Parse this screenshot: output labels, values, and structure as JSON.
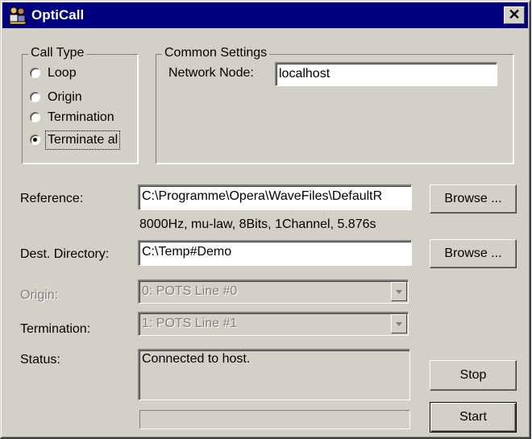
{
  "window": {
    "title": "OptiCall",
    "close_glyph": "✕"
  },
  "call_type": {
    "legend": "Call Type",
    "options": [
      {
        "label": "Loop",
        "checked": false
      },
      {
        "label": "Origin",
        "checked": false
      },
      {
        "label": "Termination",
        "checked": false
      },
      {
        "label": "Terminate al",
        "checked": true
      }
    ]
  },
  "common_settings": {
    "legend": "Common Settings",
    "network_node_label": "Network Node:",
    "network_node_value": "localhost"
  },
  "reference": {
    "label": "Reference:",
    "value": "C:\\Programme\\Opera\\WaveFiles\\DefaultR",
    "info": "8000Hz, mu-law, 8Bits, 1Channel, 5.876s",
    "browse_label": "Browse ..."
  },
  "dest_directory": {
    "label": "Dest. Directory:",
    "value": "C:\\Temp#Demo",
    "browse_label": "Browse ..."
  },
  "origin": {
    "label": "Origin:",
    "value": "0: POTS Line #0"
  },
  "termination": {
    "label": "Termination:",
    "value": "1: POTS Line #1"
  },
  "status": {
    "label": "Status:",
    "text": "Connected to host.",
    "progress": 0
  },
  "buttons": {
    "stop_label": "Stop",
    "start_label": "Start"
  },
  "icons": {
    "app": "telephone-people-icon",
    "close": "close-icon",
    "dropdown": "chevron-down-icon"
  }
}
